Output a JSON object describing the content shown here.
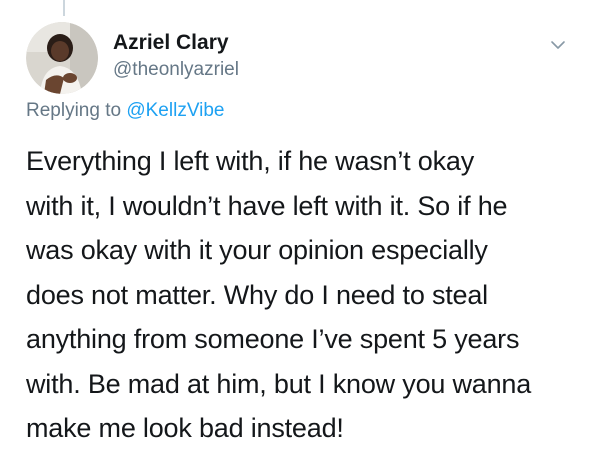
{
  "user": {
    "display_name": "Azriel Clary",
    "handle": "@theonlyazriel",
    "avatar_icon": "user-avatar-photo"
  },
  "reply": {
    "prefix": "Replying to ",
    "mention": "@KellzVibe"
  },
  "tweet": {
    "lines": [
      "Everything I left with, if he wasn’t okay",
      "with it, I wouldn’t have left with it. So if he",
      "was okay with it your opinion especially",
      "does not matter. Why do I need to steal",
      "anything from someone I’ve spent 5 years",
      "with. Be mad at him, but I know you wanna",
      "make me look bad instead!"
    ]
  },
  "menu": {
    "icon": "chevron-down-icon"
  },
  "colors": {
    "text": "#14171a",
    "secondary": "#657786",
    "accent": "#1da1f2",
    "thread_line": "#ccd6dd"
  }
}
